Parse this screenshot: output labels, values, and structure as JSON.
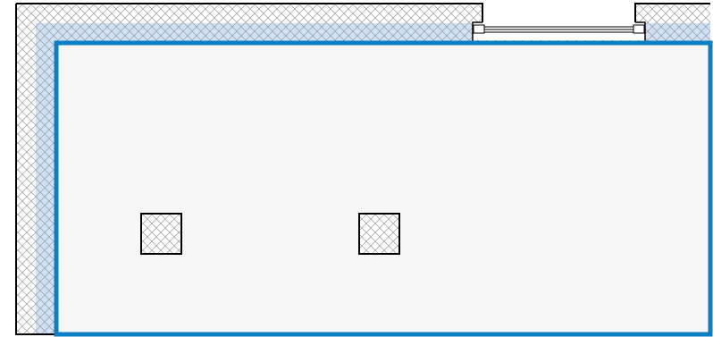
{
  "floor_plan": {
    "colors": {
      "background": "#ffffff",
      "wall_line": "#000000",
      "hatch_line": "#9a9a9a",
      "wall_fill": "#ffffff",
      "room_fill": "#f6f6f6",
      "selection_outline": "#0a7fc4",
      "selection_halo": "#cfe2f7",
      "window_line": "#000000"
    },
    "elements": {
      "walls": {
        "pattern": "crosshatch"
      },
      "window": {
        "type": "sliding-window"
      },
      "columns": [
        {
          "id": "column-1",
          "shape": "square",
          "pattern": "crosshatch"
        },
        {
          "id": "column-2",
          "shape": "square",
          "pattern": "crosshatch"
        }
      ],
      "room": {
        "state": "selected"
      }
    }
  }
}
